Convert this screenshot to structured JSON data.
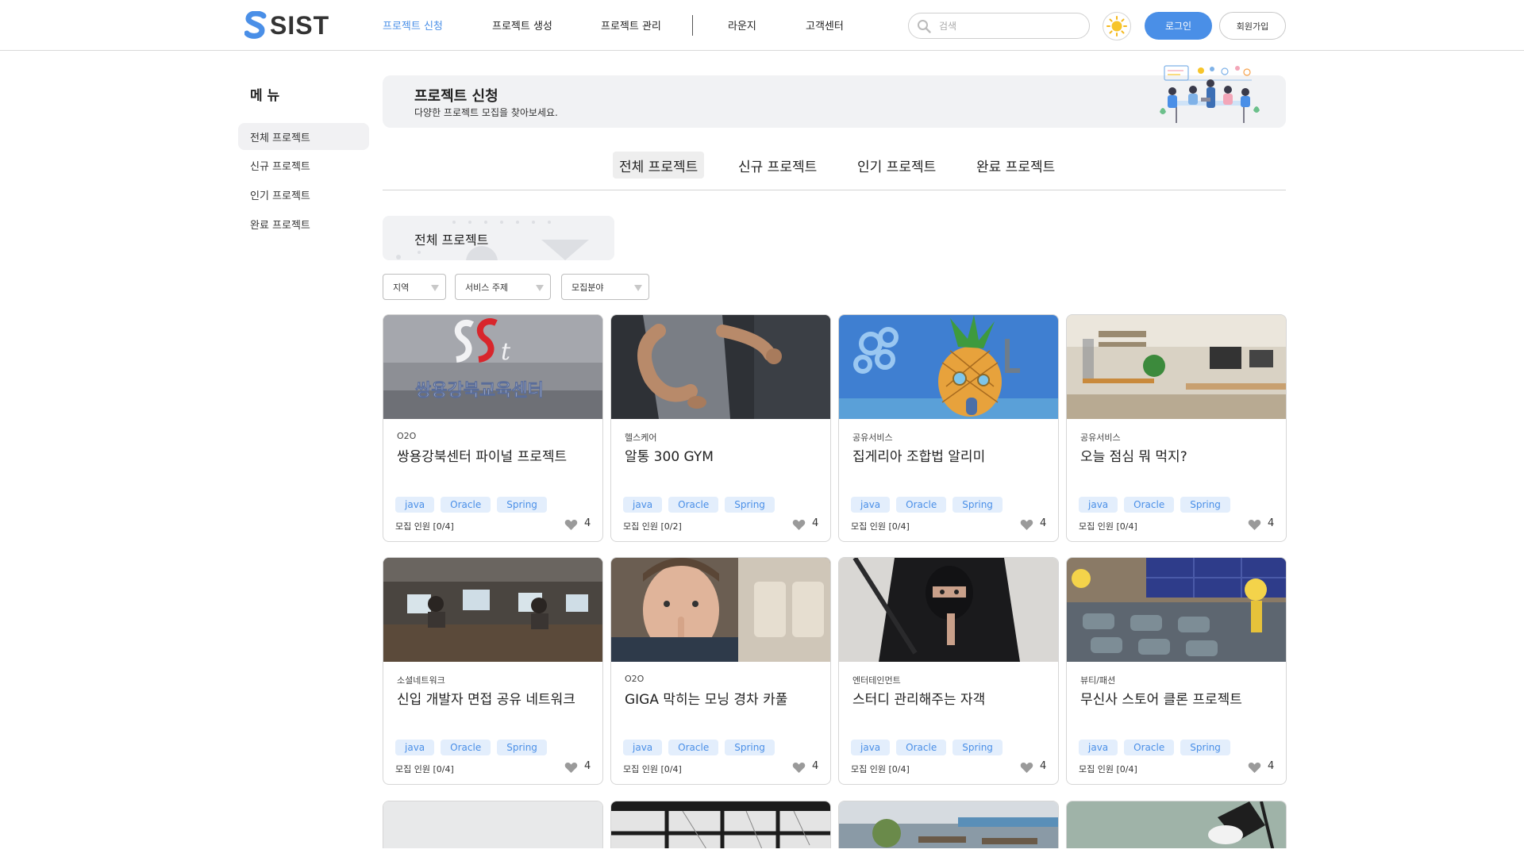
{
  "header": {
    "logo_text": "SIST",
    "nav": [
      "프로젝트 신청",
      "프로젝트 생성",
      "프로젝트 관리",
      "라운지",
      "고객센터"
    ],
    "search_placeholder": "검색",
    "login_label": "로그인",
    "signup_label": "회원가입",
    "accent": "#4a8fe7"
  },
  "sidebar": {
    "title": "메 뉴",
    "items": [
      "전체 프로젝트",
      "신규 프로젝트",
      "인기 프로젝트",
      "완료 프로젝트"
    ]
  },
  "banner": {
    "title": "프로젝트 신청",
    "subtitle": "다양한 프로젝트 모집을 찾아보세요."
  },
  "tabs": [
    "전체 프로젝트",
    "신규 프로젝트",
    "인기 프로젝트",
    "완료 프로젝트"
  ],
  "section_label": "전체 프로젝트",
  "filters": [
    "지역",
    "서비스 주제",
    "모집분야"
  ],
  "cards": [
    {
      "category": "O2O",
      "title": "쌍용강북센터 파이널 프로젝트",
      "tags": [
        "java",
        "Oracle",
        "Spring"
      ],
      "count": "모집 인원 [0/4]",
      "likes": "4",
      "image": "sist-sign"
    },
    {
      "category": "헬스케어",
      "title": "알통 300 GYM",
      "tags": [
        "java",
        "Oracle",
        "Spring"
      ],
      "count": "모집 인원 [0/2]",
      "likes": "4",
      "image": "gym"
    },
    {
      "category": "공유서비스",
      "title": "집게리아 조합법 알리미",
      "tags": [
        "java",
        "Oracle",
        "Spring"
      ],
      "count": "모집 인원 [0/4]",
      "likes": "4",
      "image": "pineapple"
    },
    {
      "category": "공유서비스",
      "title": "오늘 점심 뭐 먹지?",
      "tags": [
        "java",
        "Oracle",
        "Spring"
      ],
      "count": "모집 인원 [0/4]",
      "likes": "4",
      "image": "office"
    },
    {
      "category": "소셜네트워크",
      "title": "신입 개발자 면접 공유 네트워크",
      "tags": [
        "java",
        "Oracle",
        "Spring"
      ],
      "count": "모집 인원 [0/4]",
      "likes": "4",
      "image": "devs"
    },
    {
      "category": "O2O",
      "title": "GIGA 막히는 모닝 경차 카풀",
      "tags": [
        "java",
        "Oracle",
        "Spring"
      ],
      "count": "모집 인원 [0/4]",
      "likes": "4",
      "image": "car"
    },
    {
      "category": "엔터테인먼트",
      "title": "스터디 관리해주는 자객",
      "tags": [
        "java",
        "Oracle",
        "Spring"
      ],
      "count": "모집 인원 [0/4]",
      "likes": "4",
      "image": "ninja"
    },
    {
      "category": "뷰티/패션",
      "title": "무신사 스토어 클론 프로젝트",
      "tags": [
        "java",
        "Oracle",
        "Spring"
      ],
      "count": "모집 인원 [0/4]",
      "likes": "4",
      "image": "lounge"
    }
  ]
}
